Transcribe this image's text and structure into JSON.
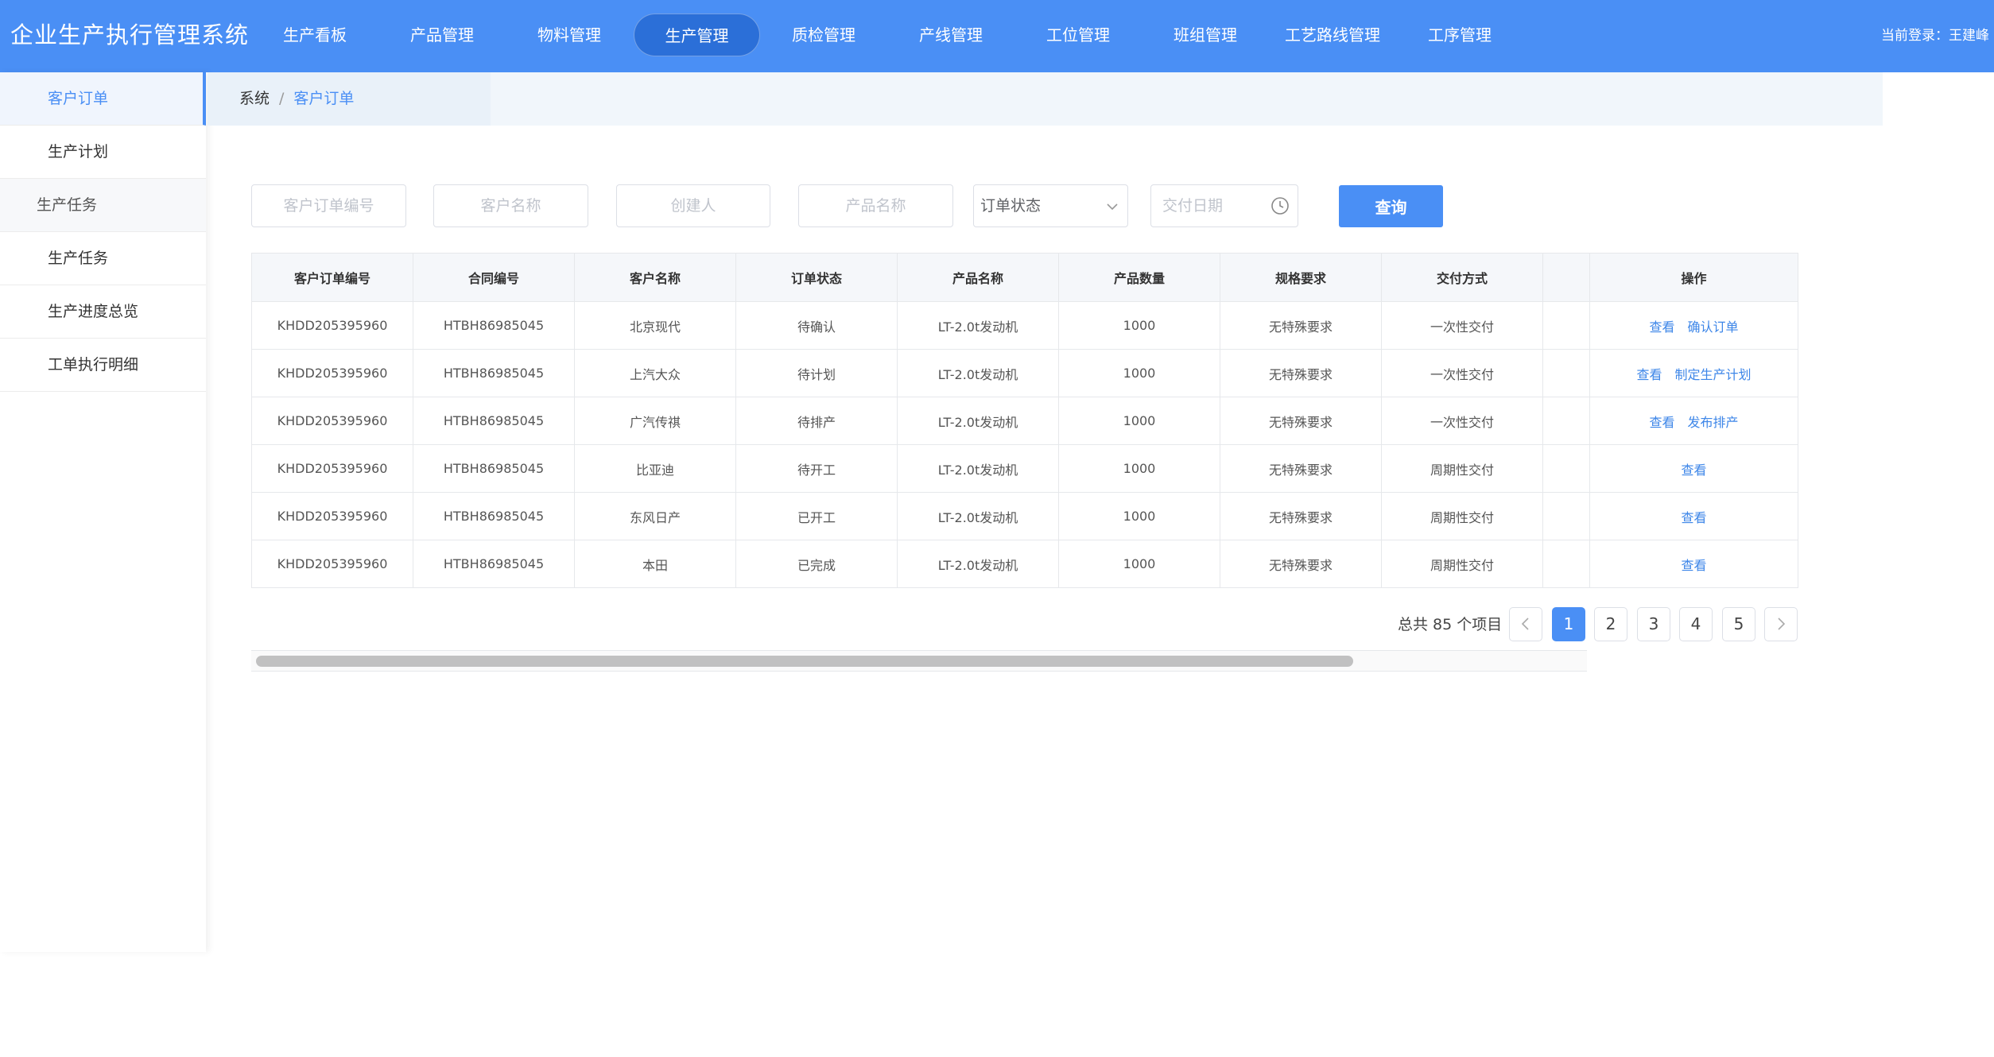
{
  "colors": {
    "brand": "#4a8ff5",
    "nav_active": "#2b6fd8",
    "link": "#3d86e8"
  },
  "header": {
    "title": "企业生产执行管理系统",
    "nav": [
      "生产看板",
      "产品管理",
      "物料管理",
      "生产管理",
      "质检管理",
      "产线管理",
      "工位管理",
      "班组管理",
      "工艺路线管理",
      "工序管理"
    ],
    "active_nav": "生产管理",
    "login": "当前登录：王建峰"
  },
  "sidebar": {
    "items": [
      {
        "label": "客户订单",
        "type": "sub",
        "active": true
      },
      {
        "label": "生产计划",
        "type": "sub"
      },
      {
        "label": "生产任务",
        "type": "group"
      },
      {
        "label": "生产任务",
        "type": "sub"
      },
      {
        "label": "生产进度总览",
        "type": "sub"
      },
      {
        "label": "工单执行明细",
        "type": "sub"
      }
    ]
  },
  "breadcrumb": {
    "root": "系统",
    "separator": "/",
    "current": "客户订单"
  },
  "filters": {
    "order_no_placeholder": "客户订单编号",
    "customer_placeholder": "客户名称",
    "creator_placeholder": "创建人",
    "product_placeholder": "产品名称",
    "status_select": "订单状态",
    "delivery_date_placeholder": "交付日期",
    "query_label": "查询"
  },
  "table": {
    "columns": [
      "客户订单编号",
      "合同编号",
      "客户名称",
      "订单状态",
      "产品名称",
      "产品数量",
      "规格要求",
      "交付方式",
      "",
      "操作"
    ],
    "rows": [
      {
        "cells": [
          "KHDD205395960",
          "HTBH86985045",
          "北京现代",
          "待确认",
          "LT-2.0t发动机",
          "1000",
          "无特殊要求",
          "一次性交付",
          ""
        ],
        "actions": [
          "查看",
          "确认订单"
        ]
      },
      {
        "cells": [
          "KHDD205395960",
          "HTBH86985045",
          "上汽大众",
          "待计划",
          "LT-2.0t发动机",
          "1000",
          "无特殊要求",
          "一次性交付",
          ""
        ],
        "actions": [
          "查看",
          "制定生产计划"
        ]
      },
      {
        "cells": [
          "KHDD205395960",
          "HTBH86985045",
          "广汽传祺",
          "待排产",
          "LT-2.0t发动机",
          "1000",
          "无特殊要求",
          "一次性交付",
          ""
        ],
        "actions": [
          "查看",
          "发布排产"
        ]
      },
      {
        "cells": [
          "KHDD205395960",
          "HTBH86985045",
          "比亚迪",
          "待开工",
          "LT-2.0t发动机",
          "1000",
          "无特殊要求",
          "周期性交付",
          ""
        ],
        "actions": [
          "查看"
        ]
      },
      {
        "cells": [
          "KHDD205395960",
          "HTBH86985045",
          "东风日产",
          "已开工",
          "LT-2.0t发动机",
          "1000",
          "无特殊要求",
          "周期性交付",
          ""
        ],
        "actions": [
          "查看"
        ]
      },
      {
        "cells": [
          "KHDD205395960",
          "HTBH86985045",
          "本田",
          "已完成",
          "LT-2.0t发动机",
          "1000",
          "无特殊要求",
          "周期性交付",
          ""
        ],
        "actions": [
          "查看"
        ]
      }
    ]
  },
  "pagination": {
    "total_text": "总共 85 个项目",
    "pages": [
      "1",
      "2",
      "3",
      "4",
      "5"
    ],
    "current": "1"
  }
}
